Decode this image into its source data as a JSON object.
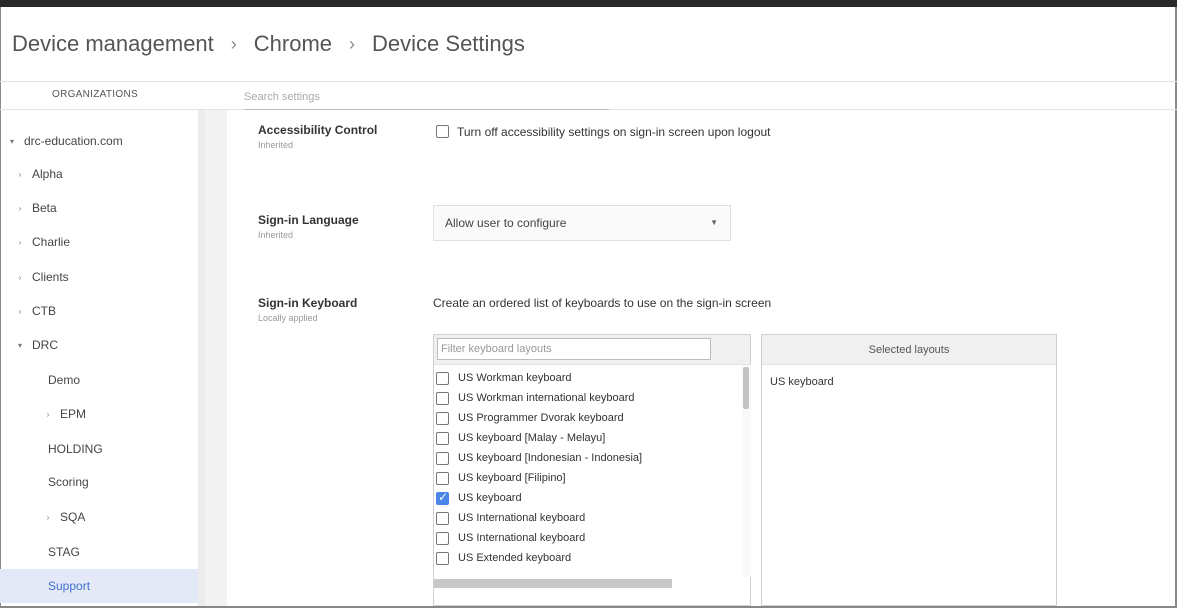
{
  "breadcrumb": {
    "items": [
      "Device management",
      "Chrome",
      "Device Settings"
    ],
    "separator": "›"
  },
  "sidebar": {
    "title": "ORGANIZATIONS",
    "items": [
      {
        "label": "drc-education.com",
        "caret": "▾"
      },
      {
        "label": "Alpha",
        "caret": "›"
      },
      {
        "label": "Beta",
        "caret": "›"
      },
      {
        "label": "Charlie",
        "caret": "›"
      },
      {
        "label": "Clients",
        "caret": "›"
      },
      {
        "label": "CTB",
        "caret": "›"
      },
      {
        "label": "DRC",
        "caret": "▾"
      },
      {
        "label": "Demo",
        "caret": ""
      },
      {
        "label": "EPM",
        "caret": "›"
      },
      {
        "label": "HOLDING",
        "caret": ""
      },
      {
        "label": "Scoring",
        "caret": ""
      },
      {
        "label": "SQA",
        "caret": "›"
      },
      {
        "label": "STAG",
        "caret": ""
      },
      {
        "label": "Support",
        "caret": ""
      }
    ]
  },
  "search": {
    "placeholder": "Search settings"
  },
  "settings": {
    "accessibility": {
      "name": "Accessibility Control",
      "sub": "Inherited",
      "checkbox_label": "Turn off accessibility settings on sign-in screen upon logout"
    },
    "language": {
      "name": "Sign-in Language",
      "sub": "Inherited",
      "selected": "Allow user to configure",
      "arrow": "▼"
    },
    "keyboard": {
      "name": "Sign-in Keyboard",
      "sub": "Locally applied",
      "description": "Create an ordered list of keyboards to use on the sign-in screen",
      "filter_placeholder": "Filter keyboard layouts",
      "layouts": [
        {
          "label": "US Workman keyboard",
          "checked": false
        },
        {
          "label": "US Workman international keyboard",
          "checked": false
        },
        {
          "label": "US Programmer Dvorak keyboard",
          "checked": false
        },
        {
          "label": "US keyboard [Malay - Melayu]",
          "checked": false
        },
        {
          "label": "US keyboard [Indonesian - Indonesia]",
          "checked": false
        },
        {
          "label": "US keyboard [Filipino]",
          "checked": false
        },
        {
          "label": "US keyboard",
          "checked": true
        },
        {
          "label": "US International keyboard",
          "checked": false
        },
        {
          "label": "US International keyboard",
          "checked": false
        },
        {
          "label": "US Extended keyboard",
          "checked": false
        }
      ],
      "selected_header": "Selected layouts",
      "selected_items": [
        "US keyboard"
      ]
    }
  },
  "colors": {
    "accent": "#4a86e8",
    "active_bg": "#e4e9f7",
    "active_text": "#3f6fd1"
  }
}
